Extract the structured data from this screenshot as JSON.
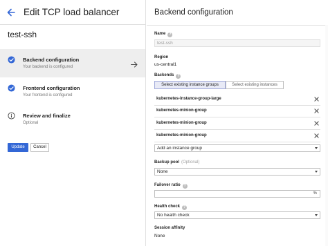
{
  "left_panel": {
    "title": "Edit TCP load balancer",
    "load_balancer_name": "test-ssh",
    "steps": [
      {
        "title": "Backend configuration",
        "subtitle": "Your backend is configured",
        "status": "complete",
        "icon": "check-circle-icon"
      },
      {
        "title": "Frontend configuration",
        "subtitle": "Your frontend is configured",
        "status": "complete",
        "icon": "check-circle-icon"
      },
      {
        "title": "Review and finalize",
        "subtitle": "Optional",
        "status": "info",
        "icon": "info-icon"
      }
    ],
    "update_label": "Update",
    "cancel_label": "Cancel"
  },
  "right_panel": {
    "title": "Backend configuration",
    "name": {
      "label": "Name",
      "placeholder": "test-ssh"
    },
    "region": {
      "label": "Region",
      "value": "us-central1"
    },
    "backends": {
      "label": "Backends",
      "tabs": [
        "Select existing instance groups",
        "Select existing instances"
      ],
      "selected_tab": "Select existing instance groups",
      "groups": [
        "kubernetes-instance-group-large",
        "kubernetes-minion-group",
        "kubernetes-minion-group",
        "kubernetes-minion-group"
      ],
      "add_placeholder": "Add an instance group"
    },
    "backup_pool": {
      "label": "Backup pool",
      "optional": "(Optional)",
      "value": "None"
    },
    "failover_ratio": {
      "label": "Failover ratio",
      "unit": "%"
    },
    "health_check": {
      "label": "Health check",
      "value": "No health check"
    },
    "session_affinity": {
      "label": "Session affinity",
      "value": "None"
    }
  },
  "colors": {
    "accent": "#3367d6",
    "check": "#3367d6",
    "selected_step_bg": "#eeeeee",
    "selected_tab_bg": "#e8eaf6"
  }
}
